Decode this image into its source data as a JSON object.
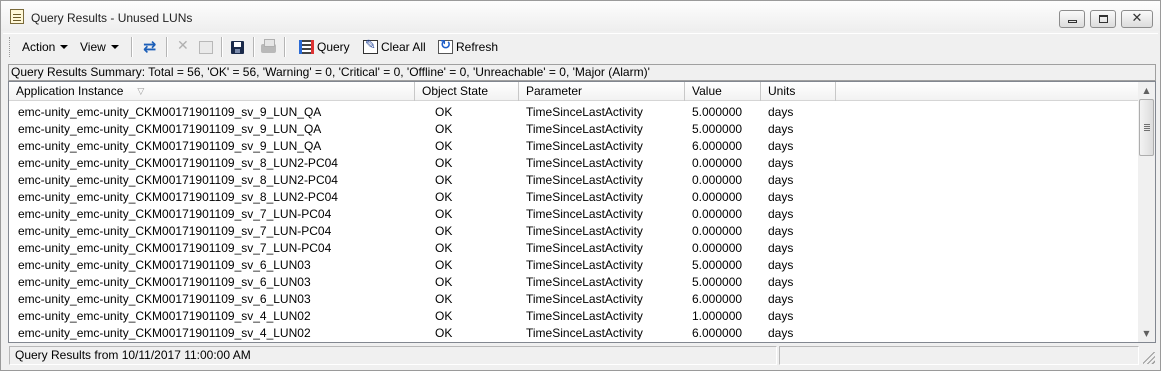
{
  "window": {
    "title": "Query Results - Unused LUNs"
  },
  "toolbar": {
    "action_label": "Action",
    "view_label": "View",
    "query_label": "Query",
    "clear_all_label": "Clear All",
    "refresh_label": "Refresh"
  },
  "summary": "Query Results Summary: Total = 56, 'OK' = 56, 'Warning' = 0, 'Critical' = 0, 'Offline' = 0, 'Unreachable' = 0, 'Major (Alarm)'",
  "table": {
    "columns": [
      "Application Instance",
      "Object State",
      "Parameter",
      "Value",
      "Units"
    ],
    "sort_column": "Application Instance",
    "rows": [
      [
        "emc-unity_emc-unity_CKM00171901109_sv_9_LUN_QA",
        "OK",
        "TimeSinceLastActivity",
        "5.000000",
        "days"
      ],
      [
        "emc-unity_emc-unity_CKM00171901109_sv_9_LUN_QA",
        "OK",
        "TimeSinceLastActivity",
        "5.000000",
        "days"
      ],
      [
        "emc-unity_emc-unity_CKM00171901109_sv_9_LUN_QA",
        "OK",
        "TimeSinceLastActivity",
        "6.000000",
        "days"
      ],
      [
        "emc-unity_emc-unity_CKM00171901109_sv_8_LUN2-PC04",
        "OK",
        "TimeSinceLastActivity",
        "0.000000",
        "days"
      ],
      [
        "emc-unity_emc-unity_CKM00171901109_sv_8_LUN2-PC04",
        "OK",
        "TimeSinceLastActivity",
        "0.000000",
        "days"
      ],
      [
        "emc-unity_emc-unity_CKM00171901109_sv_8_LUN2-PC04",
        "OK",
        "TimeSinceLastActivity",
        "0.000000",
        "days"
      ],
      [
        "emc-unity_emc-unity_CKM00171901109_sv_7_LUN-PC04",
        "OK",
        "TimeSinceLastActivity",
        "0.000000",
        "days"
      ],
      [
        "emc-unity_emc-unity_CKM00171901109_sv_7_LUN-PC04",
        "OK",
        "TimeSinceLastActivity",
        "0.000000",
        "days"
      ],
      [
        "emc-unity_emc-unity_CKM00171901109_sv_7_LUN-PC04",
        "OK",
        "TimeSinceLastActivity",
        "0.000000",
        "days"
      ],
      [
        "emc-unity_emc-unity_CKM00171901109_sv_6_LUN03",
        "OK",
        "TimeSinceLastActivity",
        "5.000000",
        "days"
      ],
      [
        "emc-unity_emc-unity_CKM00171901109_sv_6_LUN03",
        "OK",
        "TimeSinceLastActivity",
        "5.000000",
        "days"
      ],
      [
        "emc-unity_emc-unity_CKM00171901109_sv_6_LUN03",
        "OK",
        "TimeSinceLastActivity",
        "6.000000",
        "days"
      ],
      [
        "emc-unity_emc-unity_CKM00171901109_sv_4_LUN02",
        "OK",
        "TimeSinceLastActivity",
        "1.000000",
        "days"
      ],
      [
        "emc-unity_emc-unity_CKM00171901109_sv_4_LUN02",
        "OK",
        "TimeSinceLastActivity",
        "6.000000",
        "days"
      ]
    ]
  },
  "status": {
    "left": "Query Results from 10/11/2017 11:00:00 AM",
    "right": ""
  },
  "icons": {
    "title": "query-results-icon",
    "swap": "swap-arrows-icon",
    "delete": "delete-icon",
    "properties": "properties-icon",
    "save": "save-icon",
    "print": "print-icon",
    "query": "query-icon",
    "clear_all": "clear-all-icon",
    "refresh": "refresh-icon",
    "sort": "sort-descending-icon"
  }
}
